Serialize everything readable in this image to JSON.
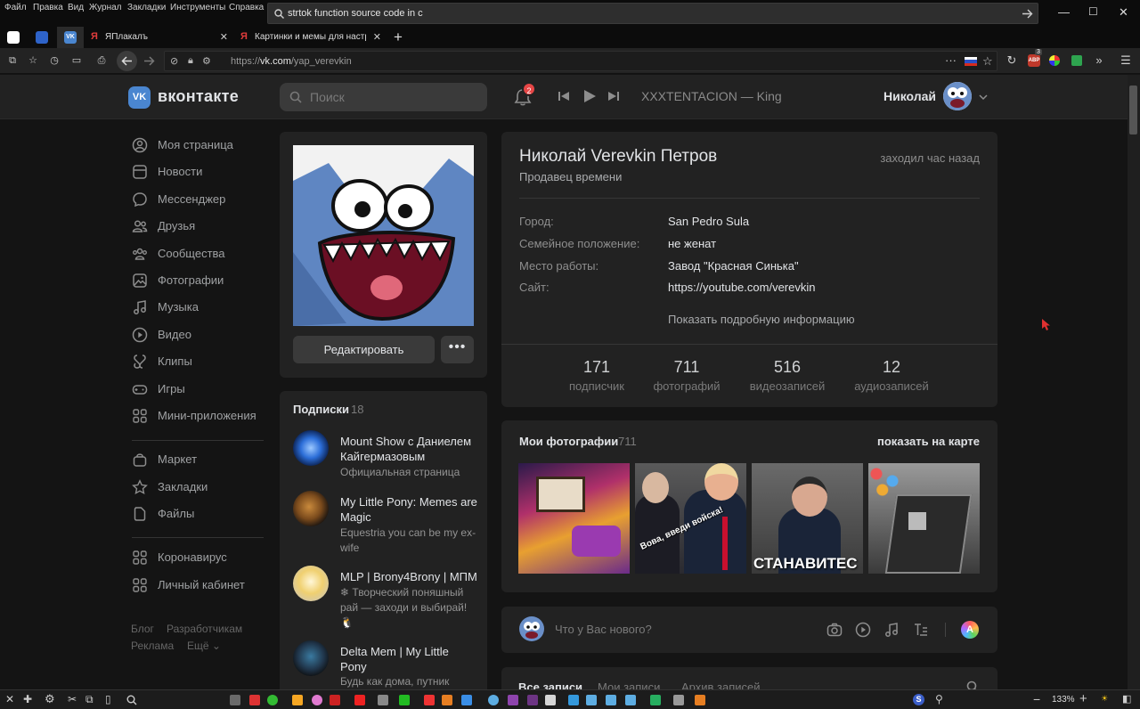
{
  "browser": {
    "menu": [
      "Файл",
      "Правка",
      "Вид",
      "Журнал",
      "Закладки",
      "Инструменты",
      "Справка"
    ],
    "search_value": "strtok function source code in c",
    "tabs": [
      {
        "label": "ЯПлакалъ"
      },
      {
        "label": "Картинки и мемы для настро"
      }
    ],
    "url_prefix": "https://",
    "url_host": "vk.com",
    "url_path": "/yap_verevkin",
    "zoom": "133%",
    "abp_badge": "3"
  },
  "header": {
    "logo_text": "вконтакте",
    "search_placeholder": "Поиск",
    "notifications_count": "2",
    "now_playing": "XXXTENTACION — King",
    "user_name": "Николай"
  },
  "sidebar": {
    "items": [
      {
        "label": "Моя страница",
        "icon": "user-circle-icon"
      },
      {
        "label": "Новости",
        "icon": "news-icon"
      },
      {
        "label": "Мессенджер",
        "icon": "message-icon"
      },
      {
        "label": "Друзья",
        "icon": "friends-icon"
      },
      {
        "label": "Сообщества",
        "icon": "groups-icon"
      },
      {
        "label": "Фотографии",
        "icon": "photo-icon"
      },
      {
        "label": "Музыка",
        "icon": "music-icon"
      },
      {
        "label": "Видео",
        "icon": "video-icon"
      },
      {
        "label": "Клипы",
        "icon": "clips-icon"
      },
      {
        "label": "Игры",
        "icon": "gamepad-icon"
      },
      {
        "label": "Мини-приложения",
        "icon": "apps-icon"
      }
    ],
    "items2": [
      {
        "label": "Маркет",
        "icon": "bag-icon"
      },
      {
        "label": "Закладки",
        "icon": "star-icon"
      },
      {
        "label": "Файлы",
        "icon": "file-icon"
      }
    ],
    "items3": [
      {
        "label": "Коронавирус",
        "icon": "apps-icon"
      },
      {
        "label": "Личный кабинет",
        "icon": "apps-icon"
      }
    ],
    "footer": {
      "blog": "Блог",
      "dev": "Разработчикам",
      "ads": "Реклама",
      "more": "Ещё"
    }
  },
  "profile": {
    "edit_label": "Редактировать",
    "name": "Николай Verevkin Петров",
    "status": "Продавец времени",
    "last_seen": "заходил час назад",
    "info": [
      {
        "label": "Город:",
        "value": "San Pedro Sula"
      },
      {
        "label": "Семейное положение:",
        "value": "не женат"
      },
      {
        "label": "Место работы:",
        "value": "Завод \"Красная Синька\""
      },
      {
        "label": "Сайт:",
        "value": "https://youtube.com/verevkin"
      }
    ],
    "show_more": "Показать подробную информацию",
    "stats": [
      {
        "n": "171",
        "label": "подписчик"
      },
      {
        "n": "711",
        "label": "фотографий"
      },
      {
        "n": "516",
        "label": "видеозаписей"
      },
      {
        "n": "12",
        "label": "аудиозаписей"
      }
    ]
  },
  "subscriptions": {
    "title": "Подписки",
    "count": "18",
    "items": [
      {
        "title": "Mount Show с Даниелем Кайгермазовым",
        "desc": "Официальная страница"
      },
      {
        "title": "My Little Pony: Memes are Magic",
        "desc": "Equestria you can be my ex-wife"
      },
      {
        "title": "MLP | Brony4Brony | МПМ",
        "desc": "❄ Творческий поняшный рай — заходи и выбирай! 🐧"
      },
      {
        "title": "Delta Mem | My Little Pony",
        "desc": "Будь как дома, путник"
      }
    ]
  },
  "photos": {
    "title": "Мои фотографии",
    "count": "711",
    "map_link": "показать на карте",
    "captions": [
      "Вова, введи войска!",
      "СТАНАВИТЕС"
    ]
  },
  "composer": {
    "placeholder": "Что у Вас нового?"
  },
  "wall_tabs": [
    "Все записи",
    "Мои записи",
    "Архив записей"
  ]
}
